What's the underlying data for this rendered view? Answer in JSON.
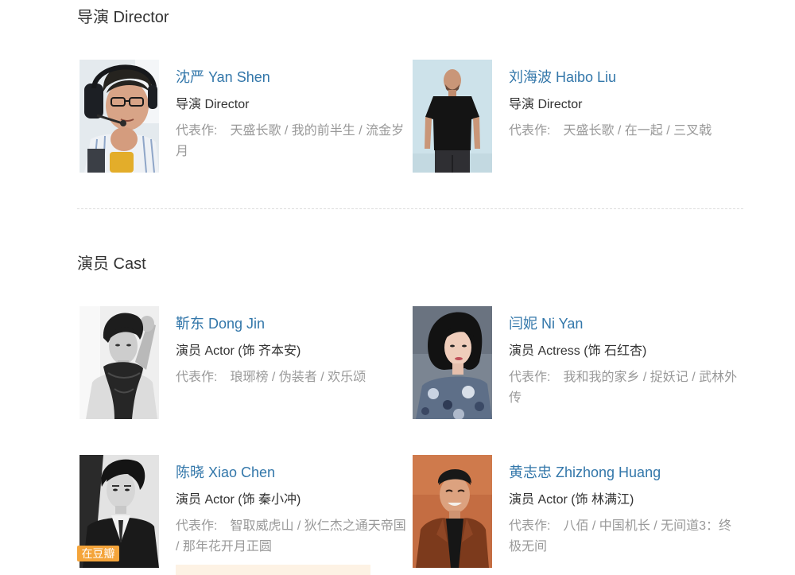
{
  "colors": {
    "link": "#3377aa",
    "text": "#333333",
    "muted": "#999999",
    "divider": "#dddddd",
    "badge_bg": "#f4a43a",
    "banner_bg": "#fdf2e4"
  },
  "labels": {
    "works": "代表作:"
  },
  "directors": {
    "title": "导演 Director",
    "people": [
      {
        "name": "沈严 Yan Shen",
        "role": "导演 Director",
        "works": "天盛长歌 / 我的前半生 / 流金岁月"
      },
      {
        "name": "刘海波 Haibo Liu",
        "role": "导演 Director",
        "works": "天盛长歌 / 在一起 / 三叉戟"
      }
    ]
  },
  "cast": {
    "title": "演员 Cast",
    "people": [
      {
        "name": "靳东 Dong Jin",
        "role": "演员 Actor (饰 齐本安)",
        "works": "琅琊榜 / 伪装者 / 欢乐颂"
      },
      {
        "name": "闫妮 Ni Yan",
        "role": "演员 Actress (饰 石红杏)",
        "works": "我和我的家乡 / 捉妖记 / 武林外传"
      },
      {
        "name": "陈晓 Xiao Chen",
        "role": "演员 Actor (饰 秦小冲)",
        "works": "智取威虎山 / 狄仁杰之通天帝国 / 那年花开月正圆"
      },
      {
        "name": "黄志忠 Zhizhong Huang",
        "role": "演员 Actor (饰 林满江)",
        "works": "八佰 / 中国机长 / 无间道3：终极无间"
      }
    ]
  },
  "badge": {
    "label": "在豆瓣"
  }
}
